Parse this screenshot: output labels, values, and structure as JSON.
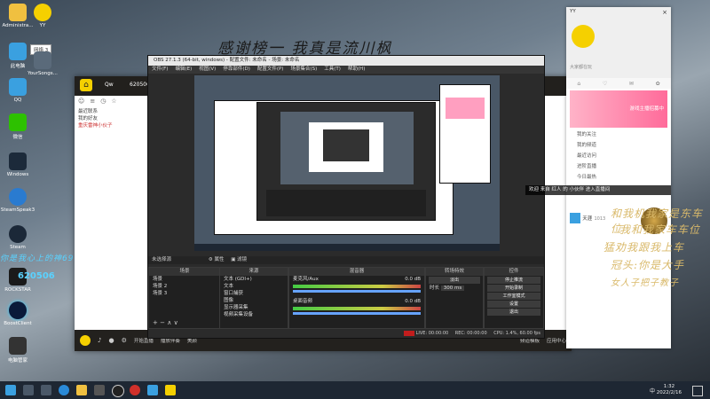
{
  "desktop": {
    "icons": [
      {
        "label": "Administra...",
        "color": "#f0c040"
      },
      {
        "label": "YY",
        "color": "#f5d000"
      },
      {
        "label": "此电脑",
        "color": "#3aa0e0"
      },
      {
        "label": "YourSongs...",
        "color": "#5a6a7a"
      },
      {
        "label": "QQ",
        "color": "#3aa0e0"
      },
      {
        "label": "微信",
        "color": "#2dc100"
      },
      {
        "label": "Windows",
        "color": "#1c2a3a"
      },
      {
        "label": "SteamSpeak3",
        "color": "#2a7bd0"
      },
      {
        "label": "Steam",
        "color": "#1b2838"
      },
      {
        "label": "ROCKSTAR",
        "color": "#1a1a1a"
      },
      {
        "label": "BoostClient",
        "color": "#0a1a3a"
      },
      {
        "label": "电脑管家",
        "color": "#333333"
      }
    ],
    "tooltip_label": "网络 3",
    "banner_text": "感谢榜一  我真是流川枫",
    "right_text": [
      "和我机我家是东车位",
      "我和我家车车位",
      "猛劝我跟我上车",
      "冠头:你是大手",
      "女人子把子教子"
    ],
    "left_text": "你是我心上的神6966",
    "score": "620506"
  },
  "yy_window": {
    "logo": "YY",
    "username": "Qw",
    "room_id": "620506",
    "group_label": "最近联系",
    "list_items": [
      "我的好友",
      "重庆雷神小伙子"
    ],
    "bottom_buttons": [
      "开始直播",
      "播放伴奏",
      "美颜"
    ],
    "bottom_right": [
      "频道模板",
      "应用中心"
    ]
  },
  "obs": {
    "title": "OBS 27.1.3 (64-bit, windows) - 配置文件: 未命名 - 场景: 未命名",
    "menu": [
      "文件(F)",
      "编辑(E)",
      "视图(V)",
      "停靠部件(D)",
      "配置文件(P)",
      "场景集合(S)",
      "工具(T)",
      "帮助(H)"
    ],
    "source_bar": {
      "label": "未选择源",
      "props": "属性",
      "filters": "滤镜"
    },
    "docks": {
      "scenes": {
        "title": "场景",
        "items": [
          "场景",
          "场景 2",
          "场景 3"
        ]
      },
      "sources": {
        "title": "来源",
        "items": [
          "文本 (GDI+)",
          "文本",
          "窗口捕获",
          "图像",
          "显示器采集",
          "视频采集设备"
        ]
      },
      "mixer": {
        "title": "混音器",
        "tracks": [
          {
            "name": "麦克风/Aux",
            "db": "0.0 dB"
          },
          {
            "name": "桌面音频",
            "db": "0.0 dB"
          }
        ]
      },
      "transitions": {
        "title": "转场特效",
        "type": "淡出",
        "duration_label": "时长",
        "duration": "300 ms"
      },
      "controls": {
        "title": "控件",
        "buttons": [
          "停止推流",
          "开始录制",
          "工作室模式",
          "设置",
          "退出"
        ]
      }
    },
    "status": {
      "live": "LIVE: 00:00:00",
      "rec": "REC: 00:00:00",
      "cpu": "CPU: 1.4%, 60.00 fps"
    }
  },
  "right_panel": {
    "title": "YY",
    "subtitle": "大家都在玩",
    "menu": [
      "我的关注",
      "我的频道",
      "最近访问",
      "进阶直播",
      "今日最热"
    ],
    "promo": "游戏主播招募中",
    "list_name": "天涯",
    "list_id": "1013"
  },
  "notice": "欢迎 来自 红人 的 小伙伴 进入直播间",
  "taskbar": {
    "time": "1:32",
    "date": "2022/2/16",
    "lang": "中",
    "icons": [
      "start",
      "search",
      "taskview",
      "edge",
      "folder",
      "store",
      "obs",
      "netease",
      "qq",
      "yy"
    ]
  },
  "colors": {
    "yy_accent": "#f5d000",
    "obs_bg": "#2b2b2b",
    "panel_pink": "#ff6b9a",
    "live_red": "#c21d1d"
  }
}
